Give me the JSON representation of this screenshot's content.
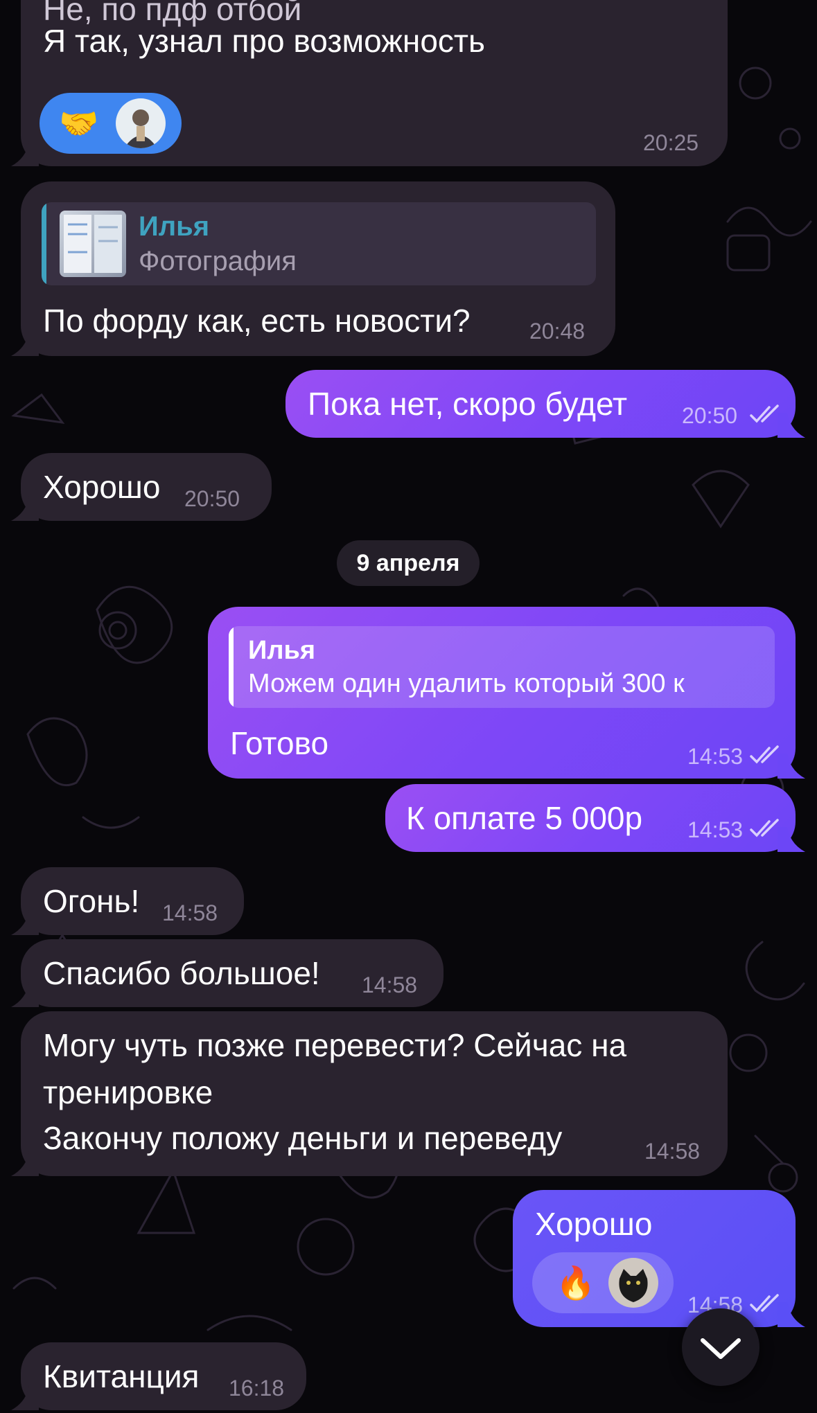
{
  "messages": {
    "m1": {
      "line1": "Не, по пдф отбой",
      "line2": "Я так, узнал про возможность",
      "time": "20:25",
      "reaction_emoji": "🤝"
    },
    "m2": {
      "reply_author": "Илья",
      "reply_text": "Фотография",
      "text": "По форду как, есть новости?",
      "time": "20:48"
    },
    "m3": {
      "text": "Пока нет, скоро будет",
      "time": "20:50"
    },
    "m4": {
      "text": "Хорошо",
      "time": "20:50"
    },
    "date_separator": "9 апреля",
    "m5": {
      "reply_author": "Илья",
      "reply_text": "Можем один удалить который 300 к",
      "text": "Готово",
      "time": "14:53"
    },
    "m6": {
      "text": "К оплате 5 000р",
      "time": "14:53"
    },
    "m7": {
      "text": "Огонь!",
      "time": "14:58"
    },
    "m8": {
      "text": "Спасибо большое!",
      "time": "14:58"
    },
    "m9": {
      "line1": "Могу чуть позже перевести? Сейчас на",
      "line2": "тренировке",
      "line3": "Закончу положу деньги и переведу",
      "time": "14:58"
    },
    "m10": {
      "text": "Хорошо",
      "time": "14:58",
      "reaction_emoji": "🔥"
    },
    "m11": {
      "text": "Квитанция",
      "time": "16:18"
    }
  },
  "colors": {
    "background": "#08070b",
    "incoming_bubble": "#2a232f",
    "outgoing_bubble": "#8a4cf5",
    "reply_accent_incoming": "#3fa3c0",
    "reaction_pill": "#3f86f0"
  },
  "icons": {
    "read_receipt": "double-check-icon",
    "scroll_down": "chevron-down-icon"
  }
}
